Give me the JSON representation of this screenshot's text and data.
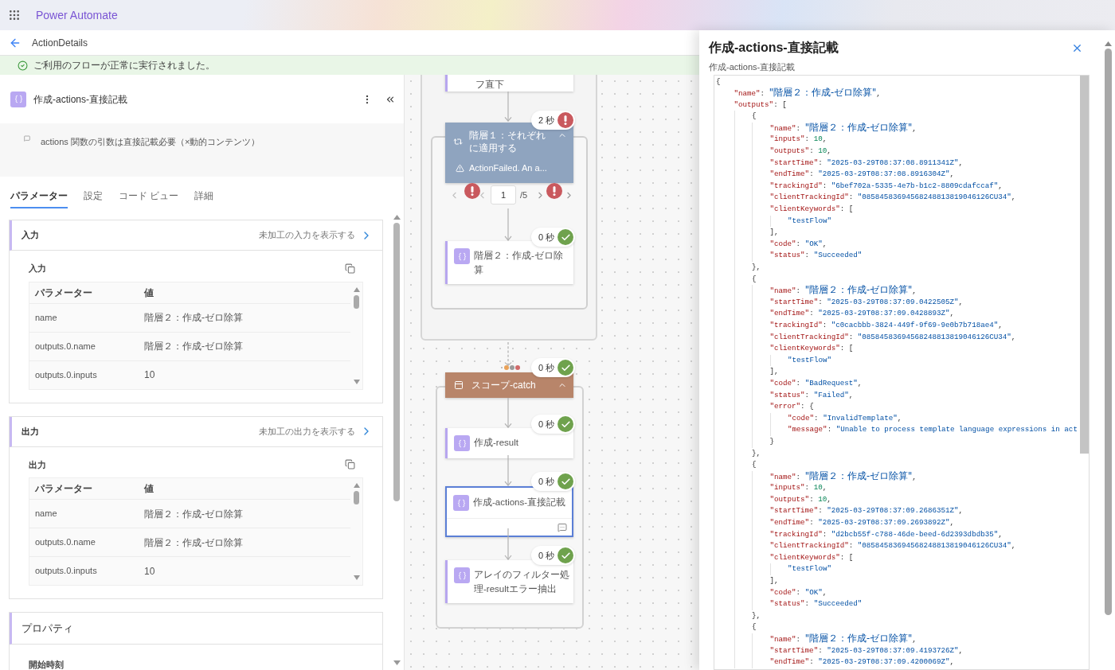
{
  "app": {
    "name": "Power Automate"
  },
  "page": {
    "title": "ActionDetails"
  },
  "banner": {
    "message": "ご利用のフローが正常に実行されました。"
  },
  "action_panel": {
    "title": "作成-actions-直接記載",
    "comment": "actions 関数の引数は直接記載必要（×動的コンテンツ）",
    "tabs": [
      {
        "label": "パラメーター",
        "selected": true
      },
      {
        "label": "設定",
        "selected": false
      },
      {
        "label": "コード ビュー",
        "selected": false
      },
      {
        "label": "詳細",
        "selected": false
      }
    ],
    "sections": [
      {
        "title": "入力",
        "link": "未加工の入力を表示する",
        "subtitle": "入力",
        "columns": [
          "パラメーター",
          "値"
        ],
        "rows": [
          [
            "name",
            "階層２：作成-ゼロ除算"
          ],
          [
            "outputs.0.name",
            "階層２：作成-ゼロ除算"
          ],
          [
            "outputs.0.inputs",
            "10"
          ]
        ]
      },
      {
        "title": "出力",
        "link": "未加工の出力を表示する",
        "subtitle": "出力",
        "columns": [
          "パラメーター",
          "値"
        ],
        "rows": [
          [
            "name",
            "階層２：作成-ゼロ除算"
          ],
          [
            "outputs.0.name",
            "階層２：作成-ゼロ除算"
          ],
          [
            "outputs.0.inputs",
            "10"
          ]
        ]
      }
    ],
    "properties": {
      "title": "プロパティ",
      "first_field": "開始時刻"
    }
  },
  "canvas": {
    "previous_action": {
      "label": "フ直下"
    },
    "loop": {
      "label": "階層１：それぞれに適用する",
      "error": "ActionFailed. An a...",
      "duration": "2 秒",
      "succeeded": false,
      "expanded": true,
      "pager": {
        "page": "1",
        "total": "/5"
      },
      "actions": [
        {
          "label": "階層２：作成-ゼロ除算",
          "duration": "0 秒",
          "succeeded": true,
          "selected": false,
          "comment": false
        }
      ]
    },
    "scope": {
      "label": "スコープ-catch",
      "duration": "0 秒",
      "succeeded": true,
      "expanded": true,
      "actions": [
        {
          "label": "作成-result",
          "duration": "0 秒",
          "succeeded": true,
          "selected": false,
          "comment": false
        },
        {
          "label": "作成-actions-直接記載",
          "duration": "0 秒",
          "succeeded": true,
          "selected": true,
          "comment": true
        },
        {
          "label": "アレイのフィルター処理-resultエラー抽出",
          "duration": "0 秒",
          "succeeded": true,
          "selected": false,
          "comment": false
        }
      ]
    }
  },
  "detail_panel": {
    "title": "作成-actions-直接記載",
    "subtitle": "作成-actions-直接記載",
    "code_lines": [
      "{",
      "    \"name\": \"階層２：作成-ゼロ除算\",",
      "    \"outputs\": [",
      "        {",
      "            \"name\": \"階層２：作成-ゼロ除算\",",
      "            \"inputs\": 10,",
      "            \"outputs\": 10,",
      "            \"startTime\": \"2025-03-29T08:37:08.8911341Z\",",
      "            \"endTime\": \"2025-03-29T08:37:08.8916304Z\",",
      "            \"trackingId\": \"6bef702a-5335-4e7b-b1c2-8809cdafccaf\",",
      "            \"clientTrackingId\": \"08584583694568248813819046126CU34\",",
      "            \"clientKeywords\": [",
      "                \"testFlow\"",
      "            ],",
      "            \"code\": \"OK\",",
      "            \"status\": \"Succeeded\"",
      "        },",
      "        {",
      "            \"name\": \"階層２：作成-ゼロ除算\",",
      "            \"startTime\": \"2025-03-29T08:37:09.0422505Z\",",
      "            \"endTime\": \"2025-03-29T08:37:09.0428893Z\",",
      "            \"trackingId\": \"c0cacbbb-3824-449f-9f69-9e0b7b718ae4\",",
      "            \"clientTrackingId\": \"08584583694568248813819046126CU34\",",
      "            \"clientKeywords\": [",
      "                \"testFlow\"",
      "            ],",
      "            \"code\": \"BadRequest\",",
      "            \"status\": \"Failed\",",
      "            \"error\": {",
      "                \"code\": \"InvalidTemplate\",",
      "                \"message\": \"Unable to process template language expressions in act",
      "            }",
      "        },",
      "        {",
      "            \"name\": \"階層２：作成-ゼロ除算\",",
      "            \"inputs\": 10,",
      "            \"outputs\": 10,",
      "            \"startTime\": \"2025-03-29T08:37:09.2686351Z\",",
      "            \"endTime\": \"2025-03-29T08:37:09.2693892Z\",",
      "            \"trackingId\": \"d2bcb55f-c788-46de-beed-6d2393dbdb35\",",
      "            \"clientTrackingId\": \"08584583694568248813819046126CU34\",",
      "            \"clientKeywords\": [",
      "                \"testFlow\"",
      "            ],",
      "            \"code\": \"OK\",",
      "            \"status\": \"Succeeded\"",
      "        },",
      "        {",
      "            \"name\": \"階層２：作成-ゼロ除算\",",
      "            \"startTime\": \"2025-03-29T08:37:09.4193726Z\",",
      "            \"endTime\": \"2025-03-29T08:37:09.4200069Z\","
    ]
  }
}
